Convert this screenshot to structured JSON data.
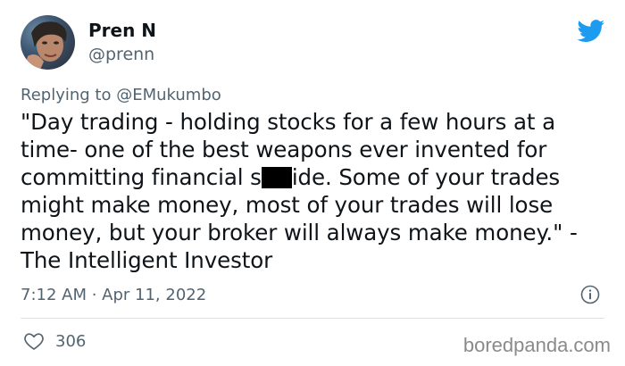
{
  "author": {
    "name": "Pren N",
    "handle": "@prenn"
  },
  "reply": {
    "prefix": "Replying to",
    "mention": "@EMukumbo"
  },
  "tweet": {
    "before_censor": "\"Day trading - holding stocks for a few hours at a time- one of the best weapons ever invented for committing financial s",
    "after_censor": "ide. Some of your trades might make money, most of your trades will lose money, but your broker will always make money.\" - The Intelligent Investor"
  },
  "meta": {
    "timestamp": "7:12 AM · Apr 11, 2022"
  },
  "stats": {
    "likes": "306"
  },
  "watermark": "boredpanda.com",
  "colors": {
    "twitter_blue": "#1d9bf0",
    "secondary_text": "#536471"
  },
  "icons": [
    "twitter-bird-icon",
    "info-icon",
    "heart-icon"
  ]
}
